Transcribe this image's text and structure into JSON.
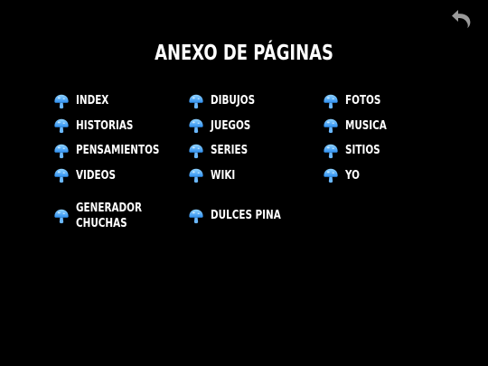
{
  "page": {
    "title": "ANEXO DE PÁGINAS",
    "background": "#000000",
    "text_color": "#ffffff",
    "icon_color": "#4aa8ff"
  },
  "back_button": {
    "icon": "undo-arrow-icon"
  },
  "links": [
    {
      "label": "INDEX"
    },
    {
      "label": "DIBUJOS"
    },
    {
      "label": "FOTOS"
    },
    {
      "label": "HISTORIAS"
    },
    {
      "label": "JUEGOS"
    },
    {
      "label": "MUSICA"
    },
    {
      "label": "PENSAMIENTOS"
    },
    {
      "label": "SERIES"
    },
    {
      "label": "SITIOS"
    },
    {
      "label": "VIDEOS"
    },
    {
      "label": "WIKI"
    },
    {
      "label": "YO"
    },
    {
      "label_line1": "GENERADOR",
      "label_line2": "CHUCHAS"
    },
    {
      "label": "DULCES PINA"
    }
  ]
}
